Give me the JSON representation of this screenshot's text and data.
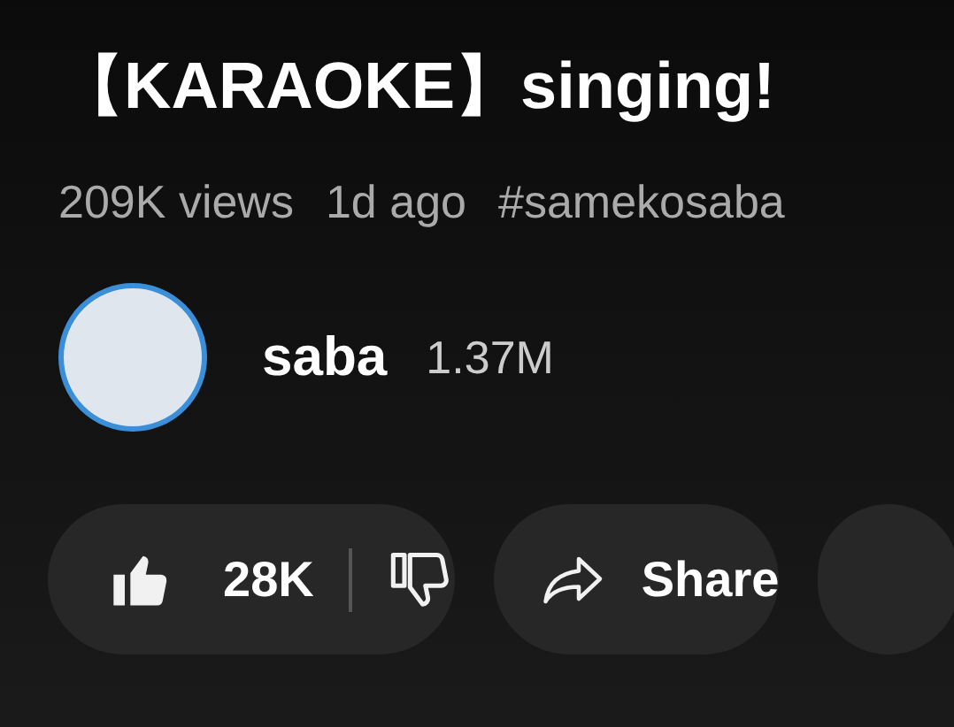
{
  "video": {
    "title": "【KARAOKE】singing!",
    "views": "209K views",
    "age": "1d ago",
    "hashtag": "#samekosaba"
  },
  "channel": {
    "name": "saba",
    "subscribers": "1.37M"
  },
  "actions": {
    "likes": "28K",
    "liked": true,
    "share_label": "Share"
  }
}
